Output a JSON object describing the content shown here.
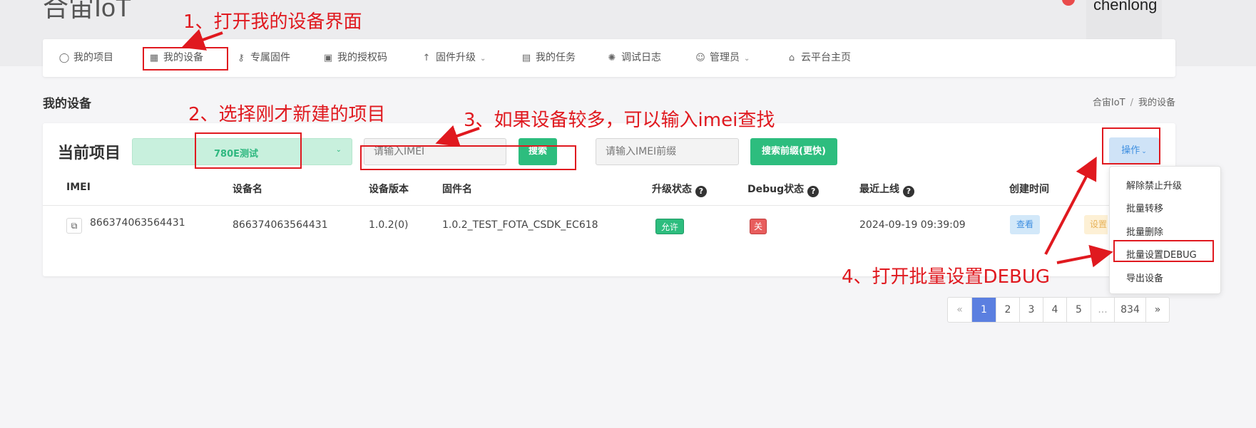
{
  "app": {
    "brand": "合宙IoT",
    "username": "chenlong"
  },
  "nav": {
    "items": [
      {
        "label": "我的项目",
        "icon": "lightbulb-icon"
      },
      {
        "label": "我的设备",
        "icon": "chip-icon"
      },
      {
        "label": "专属固件",
        "icon": "key-icon"
      },
      {
        "label": "我的授权码",
        "icon": "keyboard-icon"
      },
      {
        "label": "固件升级",
        "icon": "arrow-up-icon"
      },
      {
        "label": "我的任务",
        "icon": "calendar-icon"
      },
      {
        "label": "调试日志",
        "icon": "bug-icon"
      },
      {
        "label": "管理员",
        "icon": "user-icon"
      },
      {
        "label": "云平台主页",
        "icon": "home-icon"
      }
    ]
  },
  "page": {
    "title": "我的设备",
    "breadcrumb": [
      "合宙IoT",
      "我的设备"
    ]
  },
  "filters": {
    "current_project_label": "当前项目",
    "project_value": "780E测试",
    "imei_placeholder": "请输入IMEI",
    "search_label": "搜索",
    "prefix_placeholder": "请输入IMEI前缀",
    "prefix_search_label": "搜索前缀(更快)",
    "ops_label": "操作"
  },
  "table": {
    "columns": [
      "IMEI",
      "设备名",
      "设备版本",
      "固件名",
      "升级状态",
      "Debug状态",
      "最近上线",
      "创建时间"
    ],
    "rows": [
      {
        "imei": "866374063564431",
        "name": "866374063564431",
        "version": "1.0.2(0)",
        "firmware": "1.0.2_TEST_FOTA_CSDK_EC618",
        "upgrade_status": "允许",
        "debug_status": "关",
        "last_online": "2024-09-19 09:39:09",
        "view_label": "查看",
        "set_label": "设置"
      }
    ]
  },
  "ops_menu": {
    "items": [
      "解除禁止升级",
      "批量转移",
      "批量删除",
      "批量设置DEBUG",
      "导出设备"
    ]
  },
  "pagination": {
    "prev": "«",
    "pages": [
      "1",
      "2",
      "3",
      "4",
      "5",
      "...",
      "834"
    ],
    "next": "»",
    "current": "1"
  },
  "annotations": {
    "step1": "1、打开我的设备界面",
    "step2": "2、选择刚才新建的项目",
    "step3": "3、如果设备较多，可以输入imei查找",
    "step4": "4、打开批量设置DEBUG",
    "color": "#e0191f"
  },
  "colors": {
    "accent_green": "#2dbd7e",
    "pager_active": "#5b7fe0",
    "danger": "#e85d5d"
  }
}
